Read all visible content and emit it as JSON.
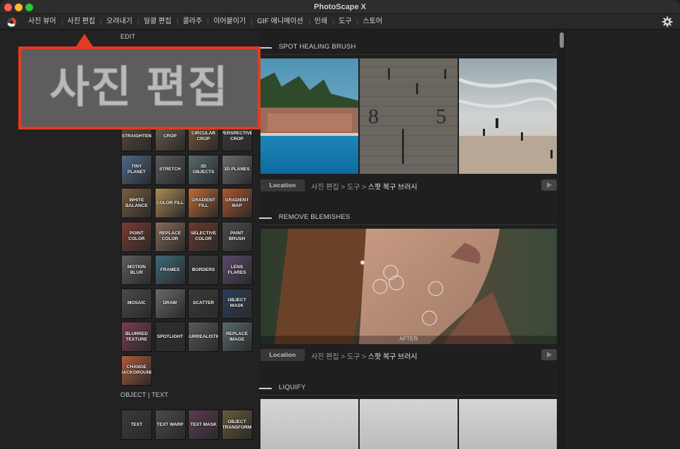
{
  "window": {
    "title": "PhotoScape X"
  },
  "menu": {
    "items": [
      "사진 뷰어",
      "사진 편집",
      "오려내기",
      "일괄 편집",
      "콜라주",
      "이어붙이기",
      "GIF 애니메이션",
      "인쇄",
      "도구",
      "스토어"
    ]
  },
  "icons": {
    "logo": "photoscape-logo",
    "settings": "gear-icon"
  },
  "callout": {
    "text": "사진 편집",
    "border_color": "#e43a22"
  },
  "left_panel": {
    "edit_header": "EDIT",
    "edit_tools": [
      "STRAIGHTEN",
      "CROP",
      "CIRCULAR CROP",
      "PERSPECTIVE CROP",
      "TINY PLANET",
      "STRETCH",
      "3D OBJECTS",
      "3D PLANES",
      "WHITE BALANCE",
      "COLOR FILL",
      "GRADIENT FILL",
      "GRADIENT MAP",
      "POINT COLOR",
      "REPLACE COLOR",
      "SELECTIVE COLOR",
      "PAINT BRUSH",
      "MOTION BLUR",
      "FRAMES",
      "BORDERS",
      "LENS FLARES",
      "MOSAIC",
      "DRAW",
      "SCATTER",
      "OBJECT MASK",
      "BLURRED TEXTURE",
      "SPOTLIGHT",
      "SURREALISTIC",
      "REPLACE IMAGE",
      "CHANGE BACKGROUND"
    ],
    "object_header": "OBJECT | TEXT",
    "object_tools": [
      "TEXT",
      "TEXT WARP",
      "TEXT MASK",
      "OBJECT TRANSFORM"
    ]
  },
  "sections": [
    {
      "title": "SPOT HEALING BRUSH",
      "location_label": "Location",
      "path_prefix": "사진 편집 > 도구 > ",
      "path_leaf": "스팟 복구 브러시"
    },
    {
      "title": "REMOVE BLEMISHES",
      "image_caption": "AFTER",
      "location_label": "Location",
      "path_prefix": "사진 편집 > 도구 > ",
      "path_leaf": "스팟 복구 브러시"
    },
    {
      "title": "LIQUIFY"
    }
  ]
}
